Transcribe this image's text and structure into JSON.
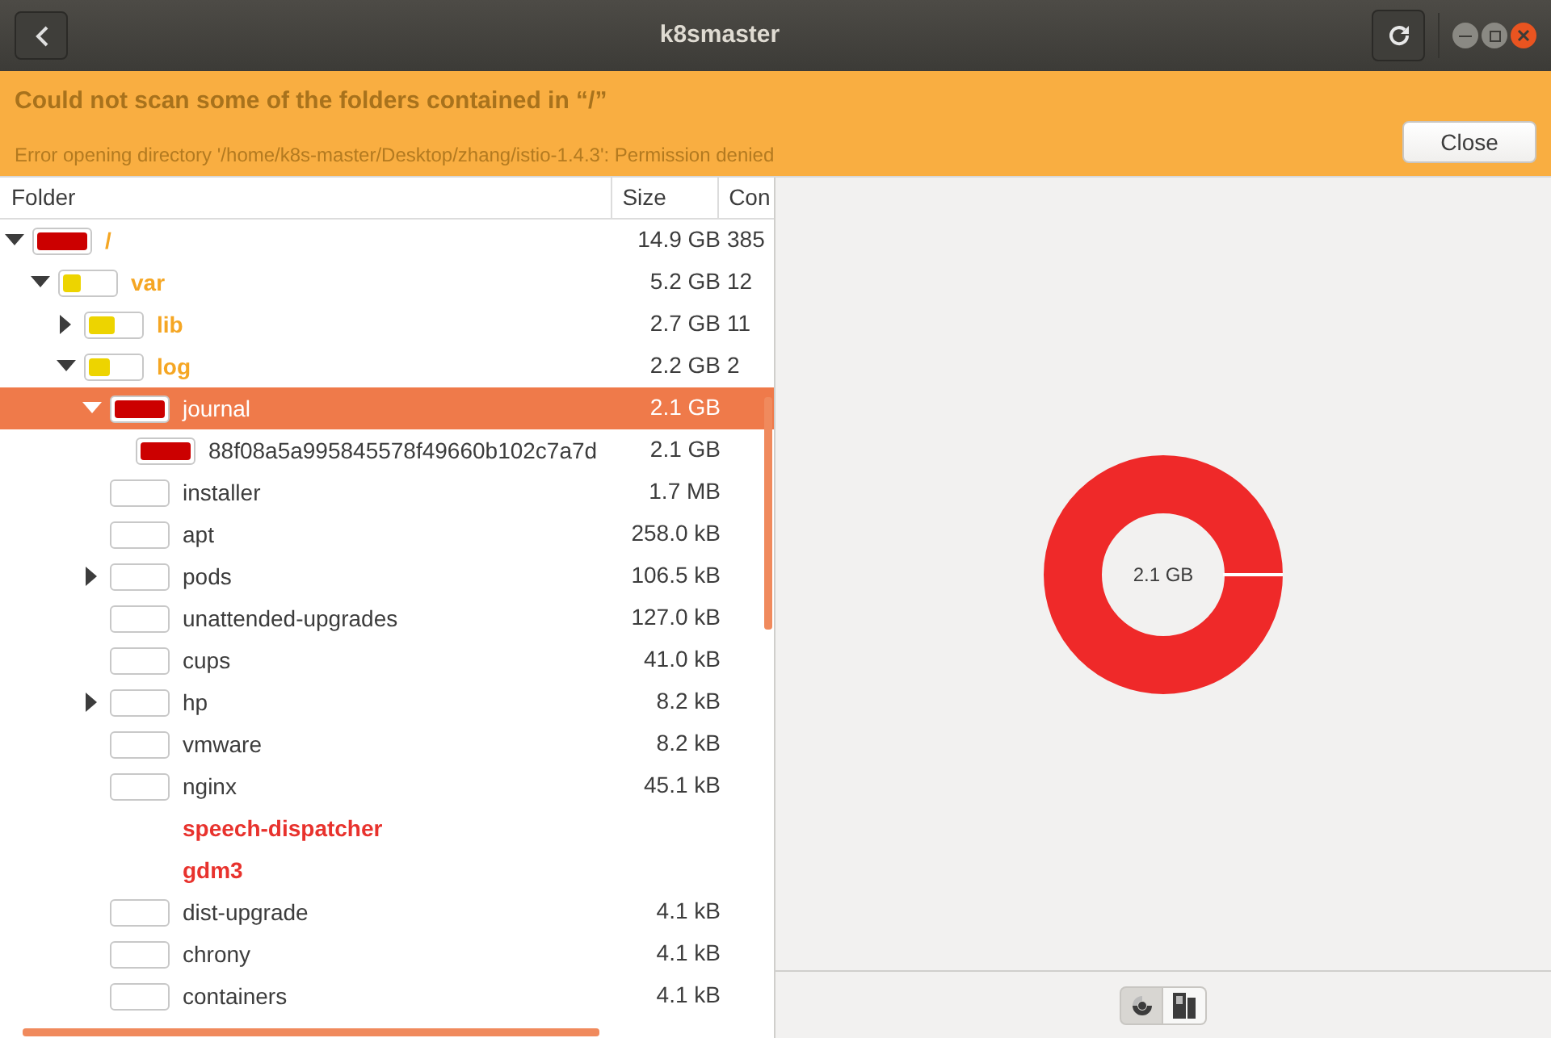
{
  "window": {
    "title": "k8smaster"
  },
  "infobar": {
    "title": "Could not scan some of the folders contained in “/”",
    "message": "Error opening directory '/home/k8s-master/Desktop/zhang/istio-1.4.3': Permission denied",
    "button": "Close"
  },
  "table": {
    "columns": [
      "Folder",
      "Size",
      "Con"
    ],
    "rows": [
      {
        "name": "/",
        "size": "14.9 GB",
        "contents": "385",
        "partial": true,
        "error": false,
        "expandable": true,
        "expanded": true,
        "selected": false,
        "level": 1,
        "color": "#cc0000",
        "children": [
          {
            "name": "var",
            "size": "5.2 GB",
            "contents": "12",
            "partial": true,
            "error": false,
            "expandable": true,
            "expanded": true,
            "selected": false,
            "level": 0.35,
            "color": "#edd400",
            "children": [
              {
                "name": "lib",
                "size": "2.7 GB",
                "contents": "11",
                "partial": true,
                "error": false,
                "expandable": true,
                "expanded": false,
                "selected": false,
                "level": 0.52,
                "color": "#edd400"
              },
              {
                "name": "log",
                "size": "2.2 GB",
                "contents": "2",
                "partial": true,
                "error": false,
                "expandable": true,
                "expanded": true,
                "selected": false,
                "level": 0.42,
                "color": "#edd400",
                "children": [
                  {
                    "name": "journal",
                    "size": "2.1 GB",
                    "partial": false,
                    "error": false,
                    "expandable": true,
                    "expanded": true,
                    "selected": true,
                    "level": 1,
                    "color": "#cc0000",
                    "children": [
                      {
                        "name": "88f08a5a995845578f49660b102c7a7d",
                        "size": "2.1 GB",
                        "partial": false,
                        "error": false,
                        "expandable": false,
                        "selected": false,
                        "level": 1,
                        "color": "#cc0000"
                      }
                    ]
                  },
                  {
                    "name": "installer",
                    "size": "1.7 MB",
                    "partial": false,
                    "error": false,
                    "expandable": false,
                    "selected": false
                  },
                  {
                    "name": "apt",
                    "size": "258.0 kB",
                    "partial": false,
                    "error": false,
                    "expandable": false,
                    "selected": false
                  },
                  {
                    "name": "pods",
                    "size": "106.5 kB",
                    "partial": false,
                    "error": false,
                    "expandable": true,
                    "expanded": false,
                    "selected": false
                  },
                  {
                    "name": "unattended-upgrades",
                    "size": "127.0 kB",
                    "partial": false,
                    "error": false,
                    "expandable": false,
                    "selected": false
                  },
                  {
                    "name": "cups",
                    "size": "41.0 kB",
                    "partial": false,
                    "error": false,
                    "expandable": false,
                    "selected": false
                  },
                  {
                    "name": "hp",
                    "size": "8.2 kB",
                    "partial": false,
                    "error": false,
                    "expandable": true,
                    "expanded": false,
                    "selected": false
                  },
                  {
                    "name": "vmware",
                    "size": "8.2 kB",
                    "partial": false,
                    "error": false,
                    "expandable": false,
                    "selected": false
                  },
                  {
                    "name": "nginx",
                    "size": "45.1 kB",
                    "partial": false,
                    "error": false,
                    "expandable": false,
                    "selected": false
                  },
                  {
                    "name": "speech-dispatcher",
                    "error": true,
                    "expandable": false,
                    "selected": false
                  },
                  {
                    "name": "gdm3",
                    "error": true,
                    "expandable": false,
                    "selected": false
                  },
                  {
                    "name": "dist-upgrade",
                    "size": "4.1 kB",
                    "partial": false,
                    "error": false,
                    "expandable": false,
                    "selected": false
                  },
                  {
                    "name": "chrony",
                    "size": "4.1 kB",
                    "partial": false,
                    "error": false,
                    "expandable": false,
                    "selected": false
                  },
                  {
                    "name": "containers",
                    "size": "4.1 kB",
                    "partial": false,
                    "error": false,
                    "expandable": false,
                    "selected": false
                  }
                ]
              }
            ]
          }
        ]
      }
    ]
  },
  "chart": {
    "center_label": "2.1 GB"
  },
  "view_buttons": [
    {
      "kind": "rings",
      "selected": true
    },
    {
      "kind": "treemap",
      "selected": false
    }
  ]
}
